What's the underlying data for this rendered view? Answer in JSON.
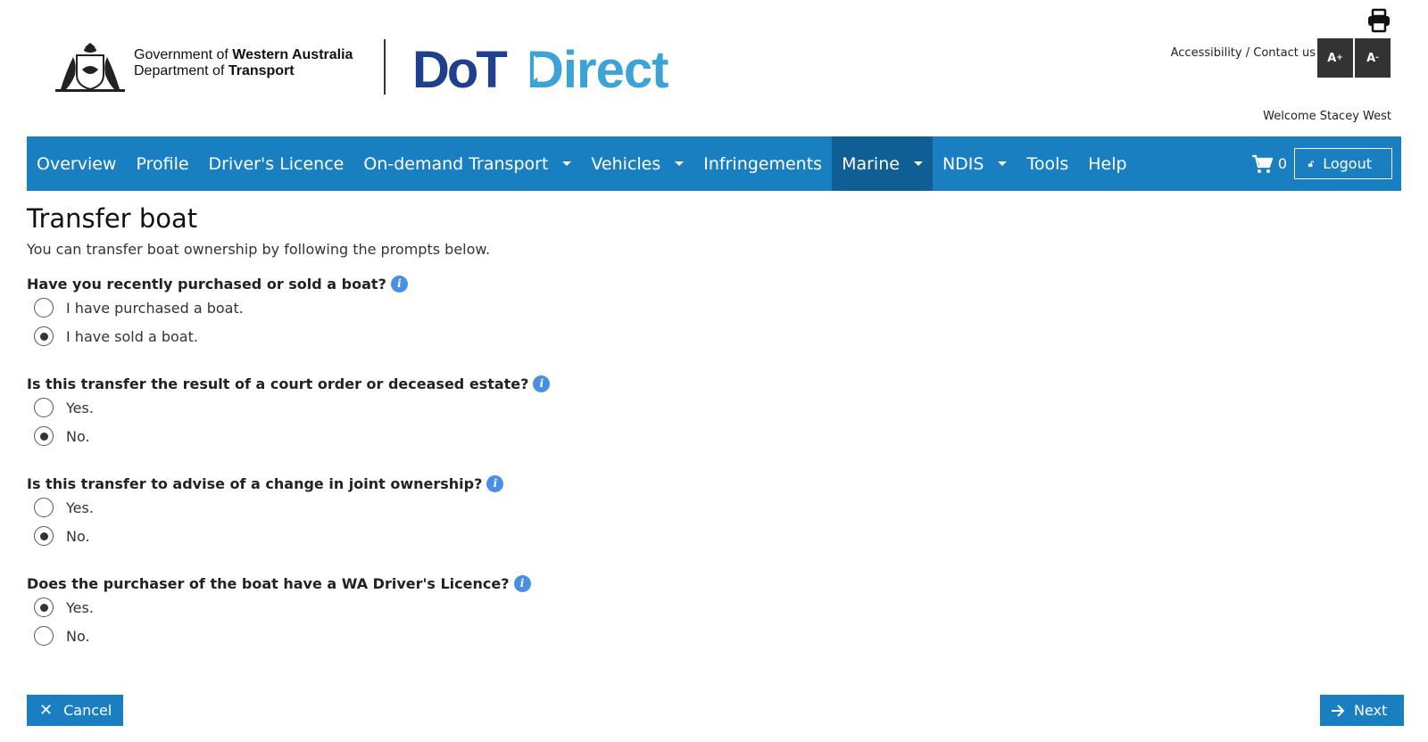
{
  "header": {
    "gov_line1_prefix": "Government of",
    "gov_line1_bold": "Western Australia",
    "gov_line2_prefix": "Department of",
    "gov_line2_bold": "Transport",
    "logo_dot": "DoT",
    "logo_direct": "Direct",
    "accessibility_link": "Accessibility",
    "link_separator": " / ",
    "contact_link": "Contact us",
    "font_increase": "A",
    "font_increase_sup": "+",
    "font_decrease": "A",
    "font_decrease_sup": "-",
    "welcome": "Welcome Stacey West",
    "icons": {
      "print": "print-icon",
      "crest": "wa-crest-icon"
    }
  },
  "nav": {
    "items": [
      {
        "label": "Overview",
        "dropdown": false,
        "active": false
      },
      {
        "label": "Profile",
        "dropdown": false,
        "active": false
      },
      {
        "label": "Driver's Licence",
        "dropdown": false,
        "active": false
      },
      {
        "label": "On-demand Transport",
        "dropdown": true,
        "active": false
      },
      {
        "label": "Vehicles",
        "dropdown": true,
        "active": false
      },
      {
        "label": "Infringements",
        "dropdown": false,
        "active": false
      },
      {
        "label": "Marine",
        "dropdown": true,
        "active": true
      },
      {
        "label": "NDIS",
        "dropdown": true,
        "active": false
      },
      {
        "label": "Tools",
        "dropdown": false,
        "active": false
      },
      {
        "label": "Help",
        "dropdown": false,
        "active": false
      }
    ],
    "cart_count": "0",
    "logout_label": "Logout"
  },
  "main": {
    "title": "Transfer boat",
    "intro": "You can transfer boat ownership by following the prompts below.",
    "questions": [
      {
        "text": "Have you recently purchased or sold a boat?",
        "options": [
          {
            "label": "I have purchased a boat.",
            "checked": false
          },
          {
            "label": "I have sold a boat.",
            "checked": true
          }
        ]
      },
      {
        "text": "Is this transfer the result of a court order or deceased estate?",
        "options": [
          {
            "label": "Yes.",
            "checked": false
          },
          {
            "label": "No.",
            "checked": true
          }
        ]
      },
      {
        "text": "Is this transfer to advise of a change in joint ownership?",
        "options": [
          {
            "label": "Yes.",
            "checked": false
          },
          {
            "label": "No.",
            "checked": true
          }
        ]
      },
      {
        "text": "Does the purchaser of the boat have a WA Driver's Licence?",
        "options": [
          {
            "label": "Yes.",
            "checked": true
          },
          {
            "label": "No.",
            "checked": false
          }
        ]
      }
    ],
    "cancel_label": "Cancel",
    "next_label": "Next"
  },
  "colors": {
    "nav_bg": "#1a7fc1",
    "nav_active": "#0f5f95",
    "logo_dark": "#1f3f8f",
    "logo_light": "#3ba3d6",
    "info": "#4a90e2"
  }
}
